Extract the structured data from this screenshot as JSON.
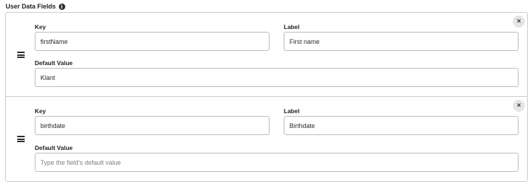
{
  "section": {
    "title": "User Data Fields",
    "info_icon": "info-icon"
  },
  "fields": [
    {
      "key_label": "Key",
      "key_value": "firstName",
      "label_label": "Label",
      "label_value": "First name",
      "default_label": "Default Value",
      "default_value": "Klant",
      "default_placeholder": ""
    },
    {
      "key_label": "Key",
      "key_value": "birthdate",
      "label_label": "Label",
      "label_value": "Birthdate",
      "default_label": "Default Value",
      "default_value": "",
      "default_placeholder": "Type the field's default value"
    }
  ],
  "remove_glyph": "×",
  "drag_icon": "drag-handle-icon"
}
